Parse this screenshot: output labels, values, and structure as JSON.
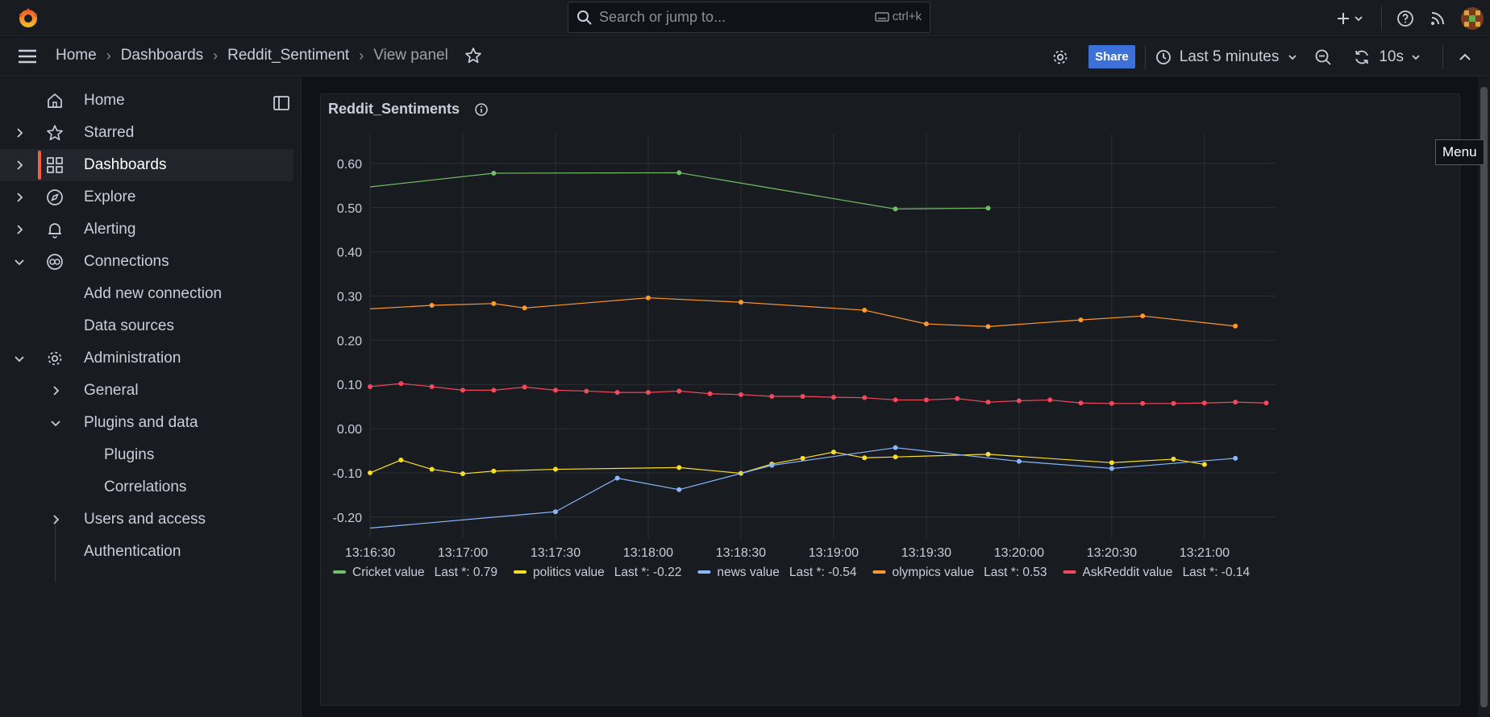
{
  "topbar": {
    "search_placeholder": "Search or jump to...",
    "search_shortcut": "ctrl+k"
  },
  "breadcrumbs": [
    "Home",
    "Dashboards",
    "Reddit_Sentiment",
    "View panel"
  ],
  "toolbar": {
    "share_label": "Share",
    "time_range_label": "Last 5 minutes",
    "refresh_interval_label": "10s"
  },
  "sidebar": {
    "items": [
      {
        "label": "Home"
      },
      {
        "label": "Starred"
      },
      {
        "label": "Dashboards"
      },
      {
        "label": "Explore"
      },
      {
        "label": "Alerting"
      },
      {
        "label": "Connections"
      },
      {
        "label": "Add new connection"
      },
      {
        "label": "Data sources"
      },
      {
        "label": "Administration"
      },
      {
        "label": "General"
      },
      {
        "label": "Plugins and data"
      },
      {
        "label": "Plugins"
      },
      {
        "label": "Correlations"
      },
      {
        "label": "Users and access"
      },
      {
        "label": "Authentication"
      }
    ]
  },
  "tooltip": "Menu",
  "panel": {
    "title": "Reddit_Sentiments"
  },
  "colors": {
    "accent": "#f55f3e",
    "share": "#3d71d9",
    "cricket": "#73bf69",
    "politics": "#fade2a",
    "news": "#8ab8ff",
    "olympics": "#ff9830",
    "askreddit": "#f2495c"
  },
  "chart_data": {
    "type": "line",
    "title": "Reddit_Sentiments",
    "xlabel": "",
    "ylabel": "",
    "x_ticks": [
      "13:16:30",
      "13:17:00",
      "13:17:30",
      "13:18:00",
      "13:18:30",
      "13:19:00",
      "13:19:30",
      "13:20:00",
      "13:20:30",
      "13:21:00"
    ],
    "xlim": [
      "13:16:30",
      "13:21:23"
    ],
    "y_ticks": [
      "0.60",
      "0.50",
      "0.40",
      "0.30",
      "0.20",
      "0.10",
      "0.00",
      "-0.10",
      "-0.20"
    ],
    "ylim": [
      -0.235,
      0.66
    ],
    "grid": true,
    "legend_position": "bottom",
    "series": [
      {
        "name": "Cricket value",
        "legend_stat": "Last *: 0.79",
        "color": "#73bf69",
        "x": [
          "13:16:30",
          "13:17:10",
          "13:18:10",
          "13:19:20",
          "13:19:50"
        ],
        "y": [
          0.547,
          0.578,
          0.579,
          0.497,
          0.499
        ],
        "points": [
          false,
          true,
          true,
          true,
          true
        ]
      },
      {
        "name": "politics value",
        "legend_stat": "Last *: -0.22",
        "color": "#fade2a",
        "x": [
          "13:16:30",
          "13:16:40",
          "13:16:50",
          "13:17:00",
          "13:17:10",
          "13:17:30",
          "13:18:10",
          "13:18:30",
          "13:18:40",
          "13:18:50",
          "13:19:00",
          "13:19:10",
          "13:19:20",
          "13:19:50",
          "13:20:30",
          "13:20:50",
          "13:21:00"
        ],
        "y": [
          -0.1,
          -0.071,
          -0.092,
          -0.102,
          -0.096,
          -0.092,
          -0.088,
          -0.101,
          -0.08,
          -0.067,
          -0.053,
          -0.066,
          -0.064,
          -0.058,
          -0.077,
          -0.069,
          -0.081
        ],
        "points": [
          true,
          true,
          true,
          true,
          true,
          true,
          true,
          true,
          true,
          true,
          true,
          true,
          true,
          true,
          true,
          true,
          true
        ]
      },
      {
        "name": "news value",
        "legend_stat": "Last *: -0.54",
        "color": "#8ab8ff",
        "x": [
          "13:16:30",
          "13:17:30",
          "13:17:50",
          "13:18:10",
          "13:18:40",
          "13:19:20",
          "13:20:00",
          "13:20:30",
          "13:21:10"
        ],
        "y": [
          -0.225,
          -0.188,
          -0.112,
          -0.138,
          -0.083,
          -0.043,
          -0.074,
          -0.09,
          -0.067
        ],
        "points": [
          false,
          true,
          true,
          true,
          true,
          true,
          true,
          true,
          true
        ]
      },
      {
        "name": "olympics value",
        "legend_stat": "Last *: 0.53",
        "color": "#ff9830",
        "x": [
          "13:16:30",
          "13:16:50",
          "13:17:10",
          "13:17:20",
          "13:18:00",
          "13:18:30",
          "13:19:10",
          "13:19:30",
          "13:19:50",
          "13:20:20",
          "13:20:40",
          "13:21:10"
        ],
        "y": [
          0.271,
          0.279,
          0.283,
          0.273,
          0.296,
          0.286,
          0.268,
          0.237,
          0.231,
          0.246,
          0.255,
          0.232
        ],
        "points": [
          false,
          true,
          true,
          true,
          true,
          true,
          true,
          true,
          true,
          true,
          true,
          true
        ]
      },
      {
        "name": "AskReddit value",
        "legend_stat": "Last *: -0.14",
        "color": "#f2495c",
        "x": [
          "13:16:30",
          "13:16:40",
          "13:16:50",
          "13:17:00",
          "13:17:10",
          "13:17:20",
          "13:17:30",
          "13:17:40",
          "13:17:50",
          "13:18:00",
          "13:18:10",
          "13:18:20",
          "13:18:30",
          "13:18:40",
          "13:18:50",
          "13:19:00",
          "13:19:10",
          "13:19:20",
          "13:19:30",
          "13:19:40",
          "13:19:50",
          "13:20:00",
          "13:20:10",
          "13:20:20",
          "13:20:30",
          "13:20:40",
          "13:20:50",
          "13:21:00",
          "13:21:10",
          "13:21:20"
        ],
        "y": [
          0.095,
          0.102,
          0.095,
          0.087,
          0.087,
          0.094,
          0.087,
          0.085,
          0.082,
          0.082,
          0.085,
          0.079,
          0.077,
          0.073,
          0.073,
          0.071,
          0.07,
          0.065,
          0.065,
          0.068,
          0.06,
          0.063,
          0.065,
          0.058,
          0.057,
          0.057,
          0.057,
          0.058,
          0.06,
          0.058
        ],
        "points": [
          true,
          true,
          true,
          true,
          true,
          true,
          true,
          true,
          true,
          true,
          true,
          true,
          true,
          true,
          true,
          true,
          true,
          true,
          true,
          true,
          true,
          true,
          true,
          true,
          true,
          true,
          true,
          true,
          true,
          true
        ]
      }
    ]
  }
}
